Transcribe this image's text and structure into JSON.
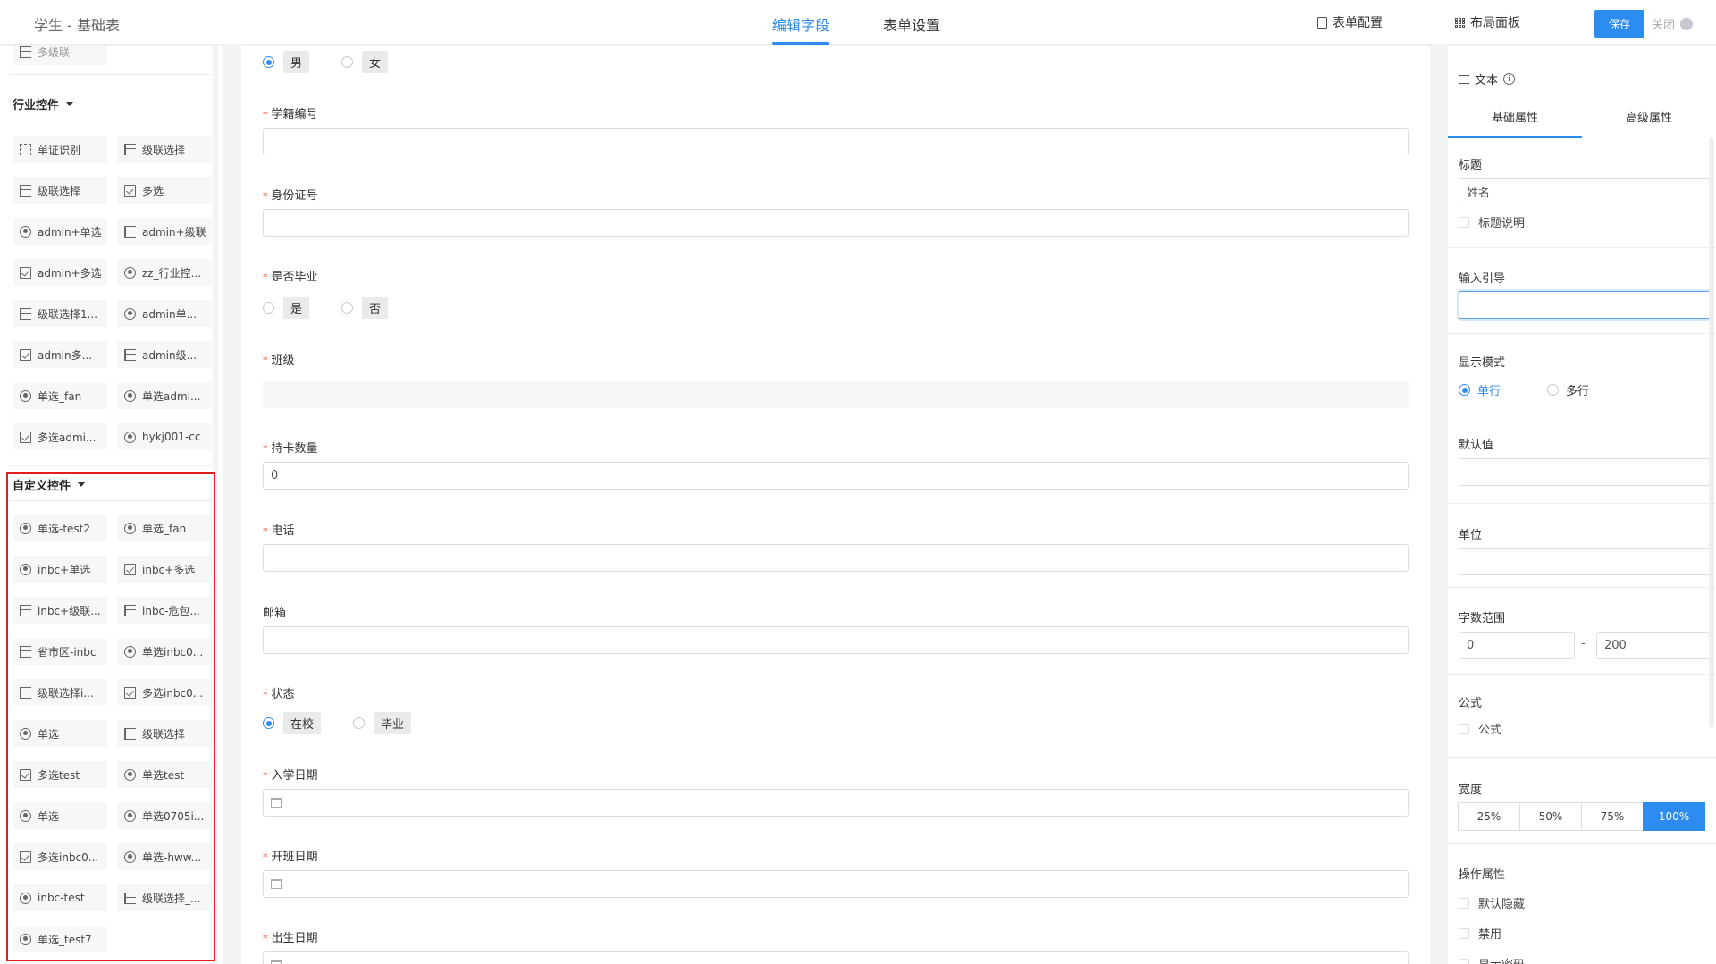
{
  "app": {
    "title": "学生 - 基础表"
  },
  "tabs": [
    {
      "label": "编辑字段",
      "active": true
    },
    {
      "label": "表单设置",
      "active": false
    }
  ],
  "toolbar": {
    "form_config": "表单配置",
    "layout_panel": "布局面板",
    "save": "保存",
    "close": "关闭"
  },
  "sidebar": {
    "partial_top": "多级联",
    "industry_title": "行业控件",
    "industry_items": [
      {
        "label": "单证识别",
        "icon": "scan-icon"
      },
      {
        "label": "级联选择",
        "icon": "cascade-icon"
      },
      {
        "label": "级联选择",
        "icon": "cascade-icon"
      },
      {
        "label": "多选",
        "icon": "checkbox-icon"
      },
      {
        "label": "admin+单选",
        "icon": "radio-icon"
      },
      {
        "label": "admin+级联",
        "icon": "cascade-icon"
      },
      {
        "label": "admin+多选",
        "icon": "checkbox-icon"
      },
      {
        "label": "zz_行业控...",
        "icon": "radio-icon"
      },
      {
        "label": "级联选择1...",
        "icon": "cascade-icon"
      },
      {
        "label": "admin单...",
        "icon": "radio-icon"
      },
      {
        "label": "admin多...",
        "icon": "checkbox-icon"
      },
      {
        "label": "admin级...",
        "icon": "cascade-icon"
      },
      {
        "label": "单选_fan",
        "icon": "radio-icon"
      },
      {
        "label": "单选admi...",
        "icon": "radio-icon"
      },
      {
        "label": "多选admi...",
        "icon": "checkbox-icon"
      },
      {
        "label": "hykj001-cc",
        "icon": "radio-icon"
      }
    ],
    "custom_title": "自定义控件",
    "custom_items": [
      {
        "label": "单选-test2",
        "icon": "radio-icon"
      },
      {
        "label": "单选_fan",
        "icon": "radio-icon"
      },
      {
        "label": "inbc+单选",
        "icon": "radio-icon"
      },
      {
        "label": "inbc+多选",
        "icon": "checkbox-icon"
      },
      {
        "label": "inbc+级联...",
        "icon": "cascade-icon"
      },
      {
        "label": "inbc-危包...",
        "icon": "cascade-icon"
      },
      {
        "label": "省市区-inbc",
        "icon": "cascade-icon"
      },
      {
        "label": "单选inbc0...",
        "icon": "radio-icon"
      },
      {
        "label": "级联选择i...",
        "icon": "cascade-icon"
      },
      {
        "label": "多选inbc0...",
        "icon": "checkbox-icon"
      },
      {
        "label": "单选",
        "icon": "radio-icon"
      },
      {
        "label": "级联选择",
        "icon": "cascade-icon"
      },
      {
        "label": "多选test",
        "icon": "checkbox-icon"
      },
      {
        "label": "单选test",
        "icon": "radio-icon"
      },
      {
        "label": "单选",
        "icon": "radio-icon"
      },
      {
        "label": "单选0705i...",
        "icon": "radio-icon"
      },
      {
        "label": "多选inbc0...",
        "icon": "checkbox-icon"
      },
      {
        "label": "单选-hww...",
        "icon": "radio-icon"
      },
      {
        "label": "inbc-test",
        "icon": "radio-icon"
      },
      {
        "label": "级联选择_...",
        "icon": "cascade-icon"
      },
      {
        "label": "单选_test7",
        "icon": "radio-icon"
      }
    ]
  },
  "form": {
    "gender": {
      "options": [
        "男",
        "女"
      ],
      "selected": "男"
    },
    "student_id": {
      "label": "学籍编号",
      "required": true,
      "value": ""
    },
    "id_card": {
      "label": "身份证号",
      "required": true,
      "value": ""
    },
    "graduated": {
      "label": "是否毕业",
      "required": true,
      "options": [
        "是",
        "否"
      ]
    },
    "class": {
      "label": "班级",
      "required": true
    },
    "card_count": {
      "label": "持卡数量",
      "required": true,
      "value": "0"
    },
    "phone": {
      "label": "电话",
      "required": true,
      "value": ""
    },
    "email": {
      "label": "邮箱",
      "required": false,
      "value": ""
    },
    "status": {
      "label": "状态",
      "required": true,
      "options": [
        "在校",
        "毕业"
      ],
      "selected": "在校"
    },
    "enroll_date": {
      "label": "入学日期",
      "required": true
    },
    "class_start_date": {
      "label": "开班日期",
      "required": true
    },
    "birth_date": {
      "label": "出生日期",
      "required": true
    }
  },
  "props": {
    "field_type": "文本",
    "tabs": [
      {
        "label": "基础属性",
        "active": true
      },
      {
        "label": "高级属性",
        "active": false
      }
    ],
    "title_label": "标题",
    "title_value": "姓名",
    "title_desc": "标题说明",
    "guide_label": "输入引导",
    "guide_value": "",
    "display_label": "显示模式",
    "display_options": [
      "单行",
      "多行"
    ],
    "display_selected": "单行",
    "default_label": "默认值",
    "default_value": "",
    "unit_label": "单位",
    "unit_value": "",
    "range_label": "字数范围",
    "range_min": "0",
    "range_sep": "-",
    "range_max": "200",
    "formula_label": "公式",
    "formula_check": "公式",
    "width_label": "宽度",
    "width_options": [
      "25%",
      "50%",
      "75%",
      "100%"
    ],
    "width_selected": "100%",
    "ops_label": "操作属性",
    "ops": [
      "默认隐藏",
      "禁用",
      "显示密码"
    ]
  },
  "colors": {
    "accent": "#2d8cf0",
    "required": "#ed4014",
    "highlight": "#e02020"
  }
}
